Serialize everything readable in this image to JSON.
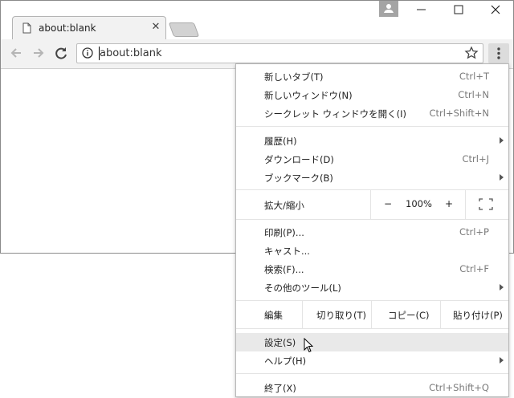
{
  "tab": {
    "title": "about:blank",
    "close": "✕"
  },
  "window_controls": {
    "minimize": "—",
    "maximize": "☐",
    "close": "✕"
  },
  "omnibox": {
    "url": "about:blank"
  },
  "menu": {
    "items_group1": [
      {
        "label": "新しいタブ(T)",
        "shortcut": "Ctrl+T"
      },
      {
        "label": "新しいウィンドウ(N)",
        "shortcut": "Ctrl+N"
      },
      {
        "label": "シークレット ウィンドウを開く(I)",
        "shortcut": "Ctrl+Shift+N"
      }
    ],
    "items_group2": [
      {
        "label": "履歴(H)",
        "shortcut": ""
      },
      {
        "label": "ダウンロード(D)",
        "shortcut": "Ctrl+J"
      },
      {
        "label": "ブックマーク(B)",
        "shortcut": ""
      }
    ],
    "zoom": {
      "label": "拡大/縮小",
      "minus": "−",
      "value": "100%",
      "plus": "+"
    },
    "items_group3": [
      {
        "label": "印刷(P)...",
        "shortcut": "Ctrl+P"
      },
      {
        "label": "キャスト...",
        "shortcut": ""
      },
      {
        "label": "検索(F)...",
        "shortcut": "Ctrl+F"
      },
      {
        "label": "その他のツール(L)",
        "shortcut": ""
      }
    ],
    "edit": {
      "label": "編集",
      "cut": "切り取り(T)",
      "copy": "コピー(C)",
      "paste": "貼り付け(P)"
    },
    "items_group4": [
      {
        "label": "設定(S)",
        "shortcut": ""
      },
      {
        "label": "ヘルプ(H)",
        "shortcut": ""
      }
    ],
    "exit": {
      "label": "終了(X)",
      "shortcut": "Ctrl+Shift+Q"
    }
  }
}
